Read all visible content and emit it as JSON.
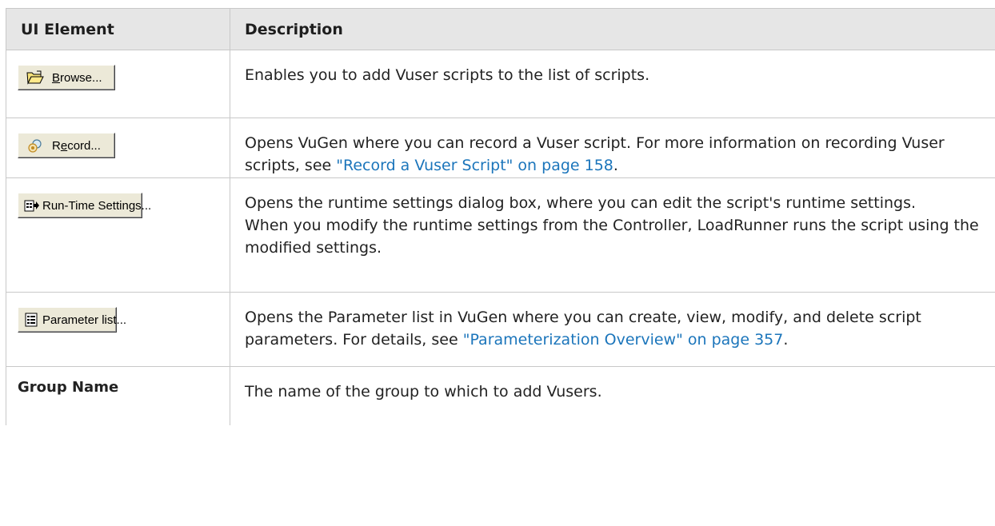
{
  "table": {
    "headers": [
      "UI Element",
      "Description"
    ],
    "rows": {
      "browse": {
        "element_label_pre": "",
        "element_label_ul": "B",
        "element_label_post": "rowse...",
        "icon": "folder-open-icon",
        "description": "Enables you to add Vuser scripts to the list of scripts."
      },
      "record": {
        "element_label_pre": "R",
        "element_label_ul": "e",
        "element_label_post": "cord...",
        "icon": "record-icon",
        "desc_text": "Opens VuGen where you can record a Vuser script. For more information on recording Vuser scripts, see ",
        "desc_link": "\"Record a Vuser Script\" on page 158",
        "desc_end": "."
      },
      "runtime": {
        "element_label": "Run-Time Settings...",
        "icon": "runtime-settings-icon",
        "desc_line1": "Opens the runtime settings dialog box, where you can edit the script's runtime settings.",
        "desc_line2": "When you modify the runtime settings from the Controller, LoadRunner runs the script using the modified settings."
      },
      "parameter": {
        "element_label": "Parameter list...",
        "icon": "parameter-list-icon",
        "desc_text": "Opens the Parameter list in VuGen where you can create, view, modify, and delete script parameters. For details, see ",
        "desc_link": "\"Parameterization Overview\" on page 357",
        "desc_end": "."
      },
      "group_name": {
        "element_label": "Group Name",
        "description": "The name of the group to which to add Vusers."
      }
    }
  },
  "colors": {
    "header_bg": "#e6e6e6",
    "border": "#c8c8c8",
    "link": "#1b75bb",
    "button_face": "#ece9d8"
  }
}
